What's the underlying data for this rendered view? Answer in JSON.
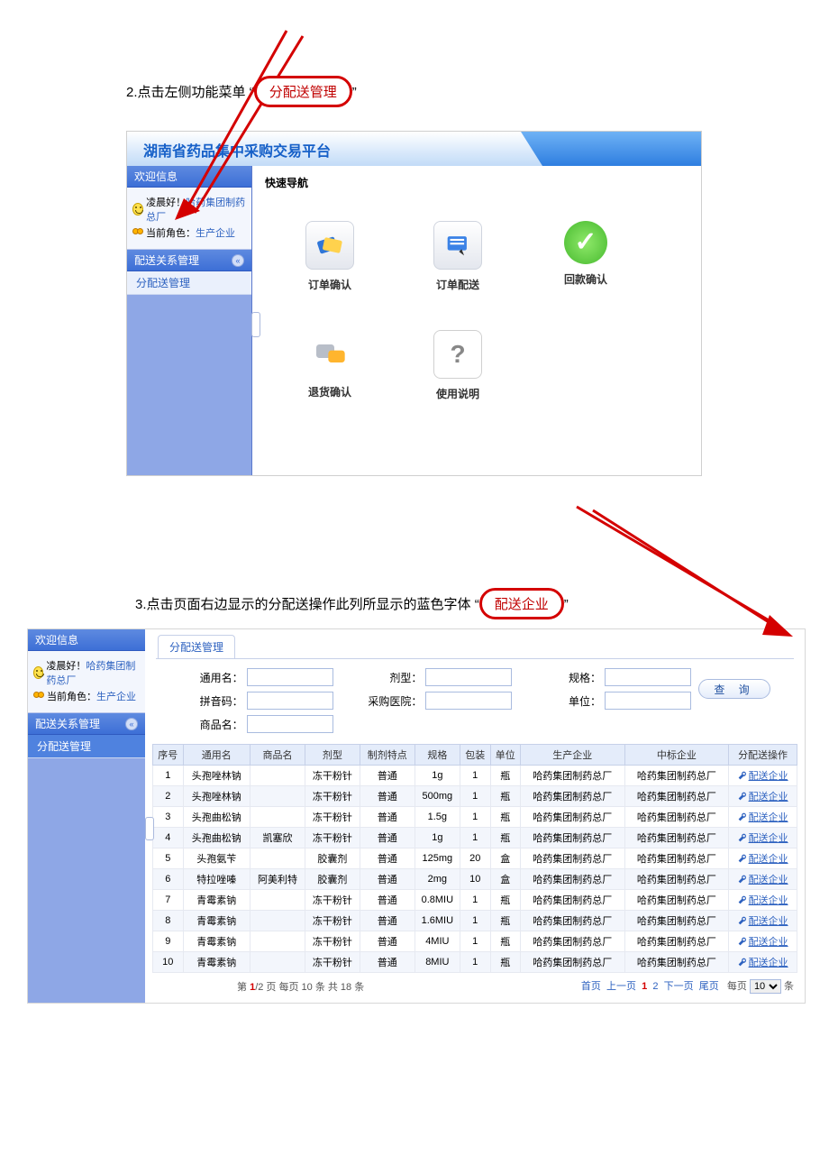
{
  "step2": {
    "instr_prefix": "2.点击左侧功能菜单",
    "quote_open": "“",
    "quote_close": "”",
    "highlight": "分配送管理"
  },
  "app": {
    "title": "湖南省药品集中采购交易平台",
    "welcome_label": "欢迎信息",
    "greeting_prefix": "凌晨好！",
    "company": "哈药集团制药总厂",
    "role_label": "当前角色：",
    "role_value": "生产企业",
    "menu_group": "配送关系管理",
    "menu_item": "分配送管理",
    "quick_label": "快速导航",
    "quick_items": [
      "订单确认",
      "订单配送",
      "回款确认",
      "退货确认",
      "使用说明"
    ]
  },
  "step3": {
    "instr_prefix": "3.点击页面右边显示的分配送操作此列所显示的蓝色字体",
    "quote_open": "“",
    "quote_close": "”",
    "highlight": "配送企业"
  },
  "panel": {
    "tab": "分配送管理",
    "filters": {
      "f1": "通用名：",
      "f2": "剂型：",
      "f3": "规格：",
      "f4": "拼音码：",
      "f5": "采购医院：",
      "f6": "单位：",
      "f7": "商品名："
    },
    "query_btn": "查 询",
    "columns": [
      "序号",
      "通用名",
      "商品名",
      "剂型",
      "制剂特点",
      "规格",
      "包装",
      "单位",
      "生产企业",
      "中标企业",
      "分配送操作"
    ],
    "op_link": "配送企业",
    "rows": [
      {
        "n": "1",
        "gen": "头孢唑林钠",
        "brand": "",
        "form": "冻干粉针",
        "trait": "普通",
        "spec": "1g",
        "pack": "1",
        "unit": "瓶",
        "mfr": "哈药集团制药总厂",
        "bid": "哈药集团制药总厂"
      },
      {
        "n": "2",
        "gen": "头孢唑林钠",
        "brand": "",
        "form": "冻干粉针",
        "trait": "普通",
        "spec": "500mg",
        "pack": "1",
        "unit": "瓶",
        "mfr": "哈药集团制药总厂",
        "bid": "哈药集团制药总厂"
      },
      {
        "n": "3",
        "gen": "头孢曲松钠",
        "brand": "",
        "form": "冻干粉针",
        "trait": "普通",
        "spec": "1.5g",
        "pack": "1",
        "unit": "瓶",
        "mfr": "哈药集团制药总厂",
        "bid": "哈药集团制药总厂"
      },
      {
        "n": "4",
        "gen": "头孢曲松钠",
        "brand": "凯塞欣",
        "form": "冻干粉针",
        "trait": "普通",
        "spec": "1g",
        "pack": "1",
        "unit": "瓶",
        "mfr": "哈药集团制药总厂",
        "bid": "哈药集团制药总厂"
      },
      {
        "n": "5",
        "gen": "头孢氨苄",
        "brand": "",
        "form": "胶囊剂",
        "trait": "普通",
        "spec": "125mg",
        "pack": "20",
        "unit": "盒",
        "mfr": "哈药集团制药总厂",
        "bid": "哈药集团制药总厂"
      },
      {
        "n": "6",
        "gen": "特拉唑嗪",
        "brand": "阿美利特",
        "form": "胶囊剂",
        "trait": "普通",
        "spec": "2mg",
        "pack": "10",
        "unit": "盒",
        "mfr": "哈药集团制药总厂",
        "bid": "哈药集团制药总厂"
      },
      {
        "n": "7",
        "gen": "青霉素钠",
        "brand": "",
        "form": "冻干粉针",
        "trait": "普通",
        "spec": "0.8MIU",
        "pack": "1",
        "unit": "瓶",
        "mfr": "哈药集团制药总厂",
        "bid": "哈药集团制药总厂"
      },
      {
        "n": "8",
        "gen": "青霉素钠",
        "brand": "",
        "form": "冻干粉针",
        "trait": "普通",
        "spec": "1.6MIU",
        "pack": "1",
        "unit": "瓶",
        "mfr": "哈药集团制药总厂",
        "bid": "哈药集团制药总厂"
      },
      {
        "n": "9",
        "gen": "青霉素钠",
        "brand": "",
        "form": "冻干粉针",
        "trait": "普通",
        "spec": "4MIU",
        "pack": "1",
        "unit": "瓶",
        "mfr": "哈药集团制药总厂",
        "bid": "哈药集团制药总厂"
      },
      {
        "n": "10",
        "gen": "青霉素钠",
        "brand": "",
        "form": "冻干粉针",
        "trait": "普通",
        "spec": "8MIU",
        "pack": "1",
        "unit": "瓶",
        "mfr": "哈药集团制药总厂",
        "bid": "哈药集团制药总厂"
      }
    ],
    "pager": {
      "summary_pre": "第 ",
      "summary_cur": "1",
      "summary_post": "/2 页 每页 10 条 共 18 条",
      "first": "首页",
      "prev": "上一页",
      "p1": "1",
      "p2": "2",
      "next": "下一页",
      "last": "尾页",
      "perpage_pre": "每页",
      "perpage_val": "10",
      "perpage_post": "条"
    }
  }
}
